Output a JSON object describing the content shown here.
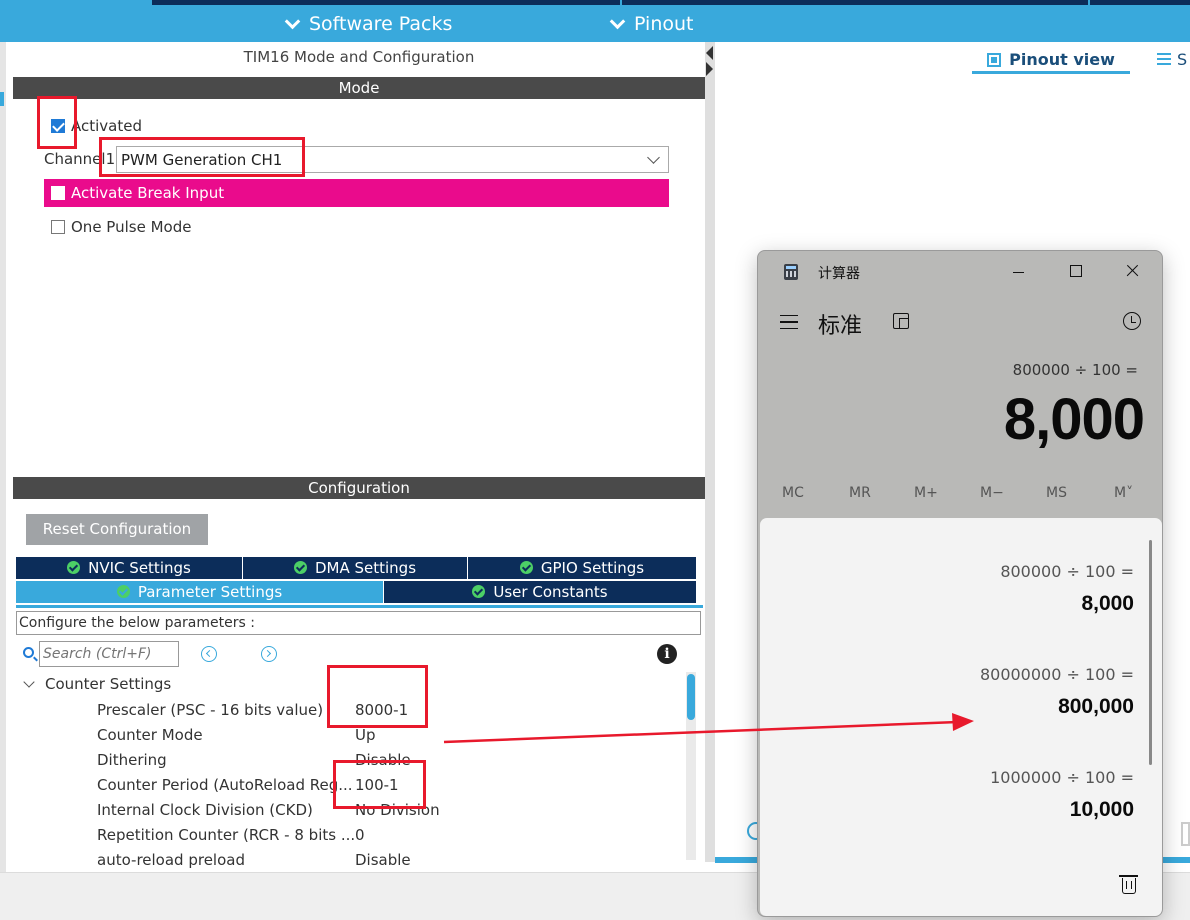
{
  "topbar": {
    "menus": [
      "Software Packs",
      "Pinout"
    ],
    "accent": "#39a9dc",
    "dark_strip": "#0c2d5a"
  },
  "panel": {
    "title": "TIM16 Mode and Configuration",
    "mode_header": "Mode",
    "activated_label": "Activated",
    "activated_checked": true,
    "channel_label": "Channel1",
    "channel_value": "PWM Generation CH1",
    "break_input_label": "Activate Break Input",
    "break_input_color": "#ea0b8c",
    "one_pulse_label": "One Pulse Mode",
    "config_header": "Configuration",
    "reset_button": "Reset Configuration"
  },
  "tabs": {
    "row1": [
      "NVIC Settings",
      "DMA Settings",
      "GPIO Settings"
    ],
    "row2": [
      "Parameter Settings",
      "User Constants"
    ],
    "active": "Parameter Settings"
  },
  "parameters": {
    "hint": "Configure the below parameters :",
    "search_placeholder": "Search (Ctrl+F)",
    "group": "Counter Settings",
    "rows": [
      {
        "name": "Prescaler (PSC - 16 bits value)",
        "value": "8000-1"
      },
      {
        "name": "Counter Mode",
        "value": "Up"
      },
      {
        "name": "Dithering",
        "value": "Disable"
      },
      {
        "name": "Counter Period (AutoReload Reg...",
        "value": "100-1"
      },
      {
        "name": "Internal Clock Division (CKD)",
        "value": "No Division"
      },
      {
        "name": "Repetition Counter (RCR - 8 bits ...",
        "value": "0"
      },
      {
        "name": "auto-reload preload",
        "value": "Disable"
      }
    ]
  },
  "right_pane": {
    "pinout_tab": "Pinout view",
    "system_tab": "S"
  },
  "calculator": {
    "title": "计算器",
    "mode": "标准",
    "expression": "800000 ÷ 100 =",
    "result": "8,000",
    "memory_buttons": [
      "MC",
      "MR",
      "M+",
      "M−",
      "MS",
      "M˅"
    ],
    "history": [
      {
        "expr": "800000  ÷  100 =",
        "result": "8,000"
      },
      {
        "expr": "80000000  ÷  100 =",
        "result": "800,000"
      },
      {
        "expr": "1000000  ÷  100 =",
        "result": "10,000"
      }
    ]
  },
  "annotation_color": "#e8192c"
}
